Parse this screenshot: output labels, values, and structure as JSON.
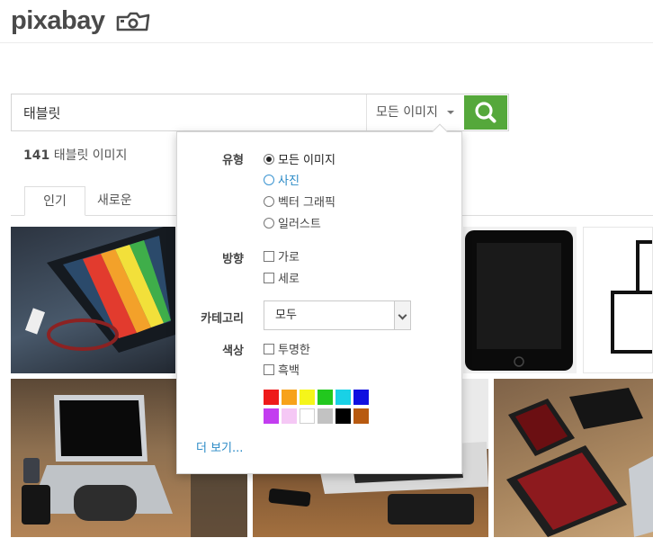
{
  "header": {
    "logo_text": "pixabay",
    "logo_icon": "camera-icon"
  },
  "search": {
    "value": "태블릿",
    "type_label": "모든 이미지",
    "button_icon": "search-icon",
    "accent_color": "#55a83b"
  },
  "results": {
    "count": "141",
    "label": "태블릿 이미지"
  },
  "tabs": [
    {
      "label": "인기",
      "active": true
    },
    {
      "label": "새로운",
      "active": false
    }
  ],
  "filters": {
    "type": {
      "label": "유형",
      "options": [
        {
          "label": "모든 이미지",
          "selected": true
        },
        {
          "label": "사진",
          "selected": false
        },
        {
          "label": "벡터 그래픽",
          "selected": false
        },
        {
          "label": "일러스트",
          "selected": false
        }
      ]
    },
    "orientation": {
      "label": "방향",
      "options": [
        {
          "label": "가로"
        },
        {
          "label": "세로"
        }
      ]
    },
    "category": {
      "label": "카테고리",
      "value": "모두"
    },
    "color": {
      "label": "색상",
      "options": [
        {
          "label": "투명한"
        },
        {
          "label": "흑백"
        }
      ],
      "swatches": [
        "#ee1a1a",
        "#f7a21b",
        "#f5f51a",
        "#22c81e",
        "#19d1e6",
        "#1010e0",
        "#c33df0",
        "#f5c8f5",
        "#ffffff",
        "#c2c2c2",
        "#000000",
        "#b85a10"
      ]
    },
    "more_label": "더 보기..."
  },
  "gallery": {
    "tiles": [
      {
        "icon": "tablet-photo-icon"
      },
      {
        "icon": "tablet-photo-icon"
      },
      {
        "icon": "device-sketch-icon"
      },
      {
        "icon": "laptop-photo-icon"
      },
      {
        "icon": "laptop-photo-icon"
      },
      {
        "icon": "tablet-photo-icon"
      }
    ]
  }
}
